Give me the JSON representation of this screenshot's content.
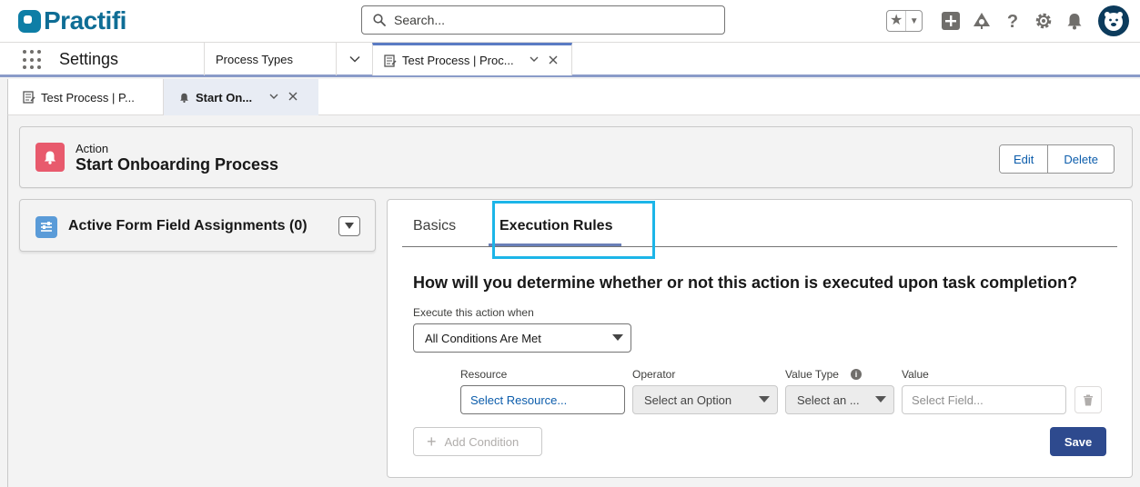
{
  "header": {
    "logo_text": "Practifi",
    "search_placeholder": "Search..."
  },
  "nav": {
    "app_name": "Settings",
    "tabs": [
      {
        "label": "Process Types"
      },
      {
        "label": "Test Process | Proc..."
      }
    ]
  },
  "subtabs": [
    {
      "label": "Test Process | P..."
    },
    {
      "label": "Start On..."
    }
  ],
  "record": {
    "type_label": "Action",
    "title": "Start Onboarding Process",
    "edit_label": "Edit",
    "delete_label": "Delete",
    "icon_color": "#e85a6d"
  },
  "left_card": {
    "title": "Active Form Field Assignments (0)"
  },
  "main": {
    "tabs": [
      {
        "label": "Basics"
      },
      {
        "label": "Execution Rules"
      }
    ],
    "active_tab": "Execution Rules",
    "question": "How will you determine whether or not this action is executed upon task completion?",
    "execute_label": "Execute this action when",
    "execute_value": "All Conditions Are Met",
    "condition": {
      "resource_label": "Resource",
      "resource_value": "Select Resource...",
      "operator_label": "Operator",
      "operator_value": "Select an Option",
      "value_type_label": "Value Type",
      "value_type_value": "Select an ...",
      "value_label": "Value",
      "value_placeholder": "Select Field..."
    },
    "add_condition_label": "Add Condition",
    "save_label": "Save"
  },
  "colors": {
    "brand": "#0e6d95",
    "highlight": "#1cb5e8",
    "save_button": "#2e4a8e"
  }
}
